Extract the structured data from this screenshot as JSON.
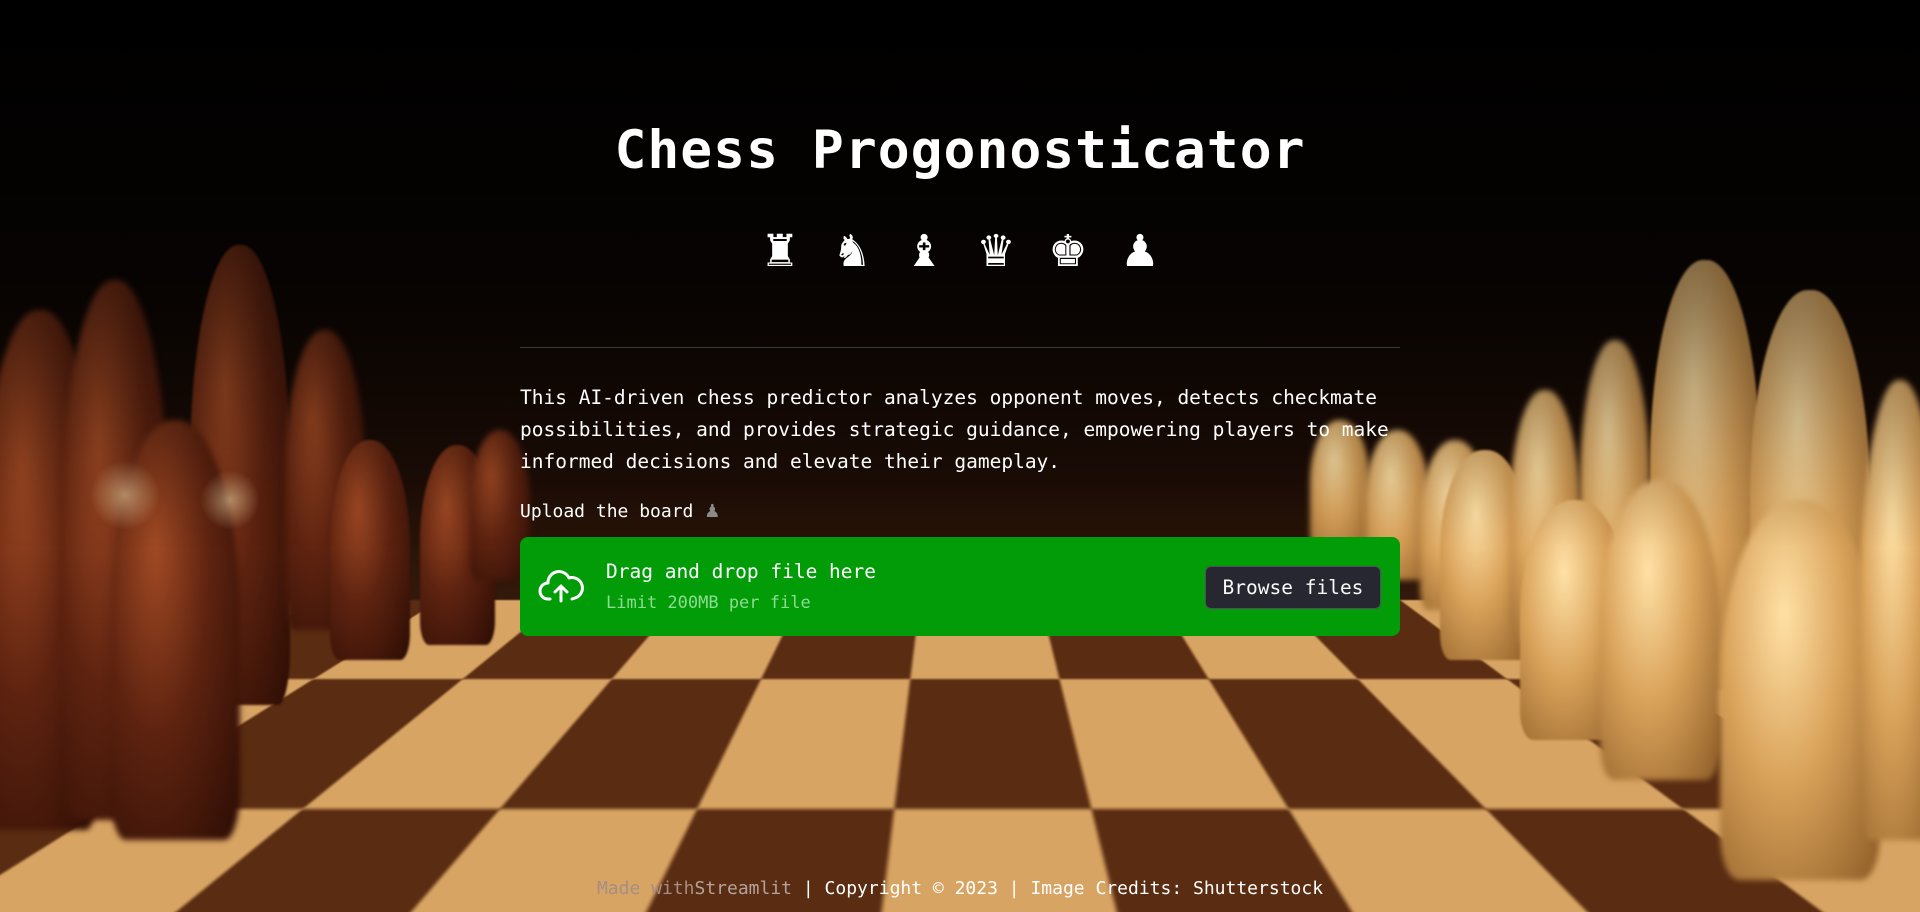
{
  "app": {
    "title": "Chess Progonosticator",
    "pieces": [
      "♜",
      "♞",
      "♝",
      "♛",
      "♚",
      "♟"
    ],
    "description": "This AI-driven chess predictor analyzes opponent moves, detects checkmate possibilities, and provides strategic guidance, empowering players to make informed decisions and elevate their gameplay."
  },
  "uploader": {
    "label": "Upload the board",
    "label_icon": "♟",
    "drop_title": "Drag and drop file here",
    "drop_limit": "Limit 200MB per file",
    "browse_label": "Browse files",
    "icon": "cloud-upload-icon",
    "background_color": "#019c07"
  },
  "footer": {
    "made_with": "Made with",
    "streamlit": "Streamlit",
    "rest": " | Copyright © 2023 | Image Credits: Shutterstock"
  }
}
